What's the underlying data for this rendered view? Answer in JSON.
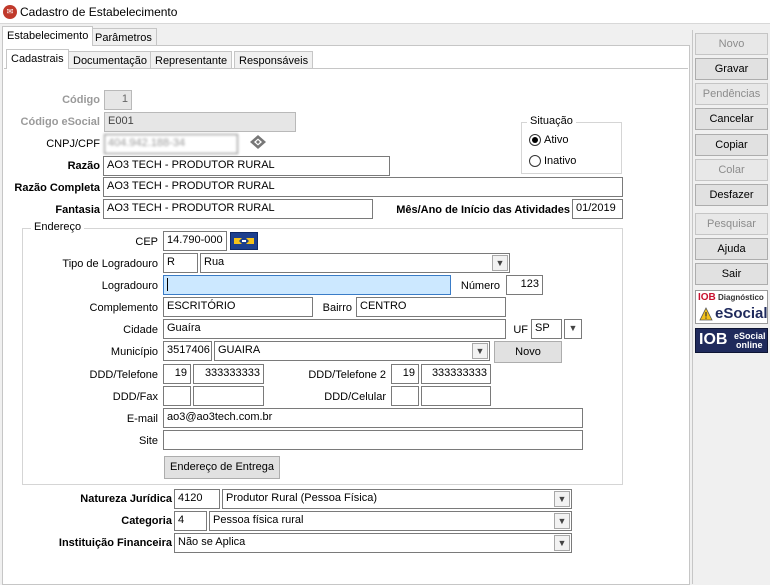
{
  "window": {
    "title": "Cadastro de Estabelecimento"
  },
  "top_tabs": [
    {
      "label": "Estabelecimento"
    },
    {
      "label": "Parâmetros"
    }
  ],
  "sub_tabs": [
    {
      "label": "Cadastrais"
    },
    {
      "label": "Documentação"
    },
    {
      "label": "Representante"
    },
    {
      "label": "Responsáveis"
    }
  ],
  "form": {
    "codigo_label": "Código",
    "codigo_value": "1",
    "codigo_esocial_label": "Código eSocial",
    "codigo_esocial_value": "E001",
    "cnpj_label": "CNPJ/CPF",
    "cnpj_value": "404.942.188-34",
    "razao_label": "Razão",
    "razao_value": "AO3 TECH - PRODUTOR RURAL",
    "razao_completa_label": "Razão Completa",
    "razao_completa_value": "AO3 TECH - PRODUTOR RURAL",
    "fantasia_label": "Fantasia",
    "fantasia_value": "AO3 TECH - PRODUTOR RURAL",
    "inicio_atividades_label": "Mês/Ano de Início das Atividades",
    "inicio_atividades_value": "01/2019"
  },
  "situacao": {
    "title": "Situação",
    "ativo": "Ativo",
    "inativo": "Inativo",
    "selected": "Ativo"
  },
  "endereco": {
    "title": "Endereço",
    "cep_label": "CEP",
    "cep_value": "14.790-000",
    "tipo_logradouro_label": "Tipo de Logradouro",
    "tipo_logradouro_code": "R",
    "tipo_logradouro_value": "Rua",
    "logradouro_label": "Logradouro",
    "logradouro_value": "",
    "numero_label": "Número",
    "numero_value": "123",
    "complemento_label": "Complemento",
    "complemento_value": "ESCRITÓRIO",
    "bairro_label": "Bairro",
    "bairro_value": "CENTRO",
    "cidade_label": "Cidade",
    "cidade_value": "Guaíra",
    "uf_label": "UF",
    "uf_value": "SP",
    "municipio_label": "Município",
    "municipio_code": "3517406",
    "municipio_value": "GUAIRA",
    "novo_button": "Novo",
    "ddd_telefone_label": "DDD/Telefone",
    "ddd1": "19",
    "tel1": "333333333",
    "ddd_telefone2_label": "DDD/Telefone 2",
    "ddd2": "19",
    "tel2": "333333333",
    "ddd_fax_label": "DDD/Fax",
    "ddd_fax": "",
    "fax": "",
    "ddd_celular_label": "DDD/Celular",
    "ddd_cel": "",
    "cel": "",
    "email_label": "E-mail",
    "email_value": "ao3@ao3tech.com.br",
    "site_label": "Site",
    "site_value": "",
    "entrega_button": "Endereço de Entrega"
  },
  "natureza": {
    "label": "Natureza Jurídica",
    "code": "4120",
    "value": "Produtor Rural (Pessoa Física)"
  },
  "categoria": {
    "label": "Categoria",
    "code": "4",
    "value": "Pessoa física rural"
  },
  "instituicao": {
    "label": "Instituição Financeira",
    "value": "Não se Aplica"
  },
  "side_buttons": {
    "novo": "Novo",
    "gravar": "Gravar",
    "pendencias": "Pendências",
    "cancelar": "Cancelar",
    "copiar": "Copiar",
    "colar": "Colar",
    "desfazer": "Desfazer",
    "pesquisar": "Pesquisar",
    "ajuda": "Ajuda",
    "sair": "Sair"
  },
  "logos": {
    "diag_top": "IOB",
    "diag_sub": "Diagnóstico",
    "diag_main": "eSocial",
    "online_top": "IOB",
    "online_sub1": "eSocial",
    "online_sub2": "online"
  },
  "colors": {
    "focus_field": "#cce8ff",
    "iob_red": "#c8102e",
    "online_bg": "#1f2a5c"
  }
}
